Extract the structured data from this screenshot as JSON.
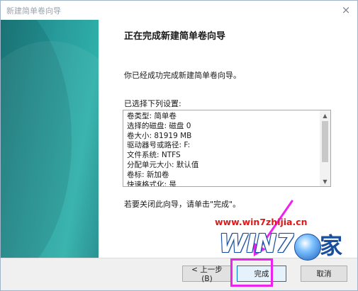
{
  "window": {
    "title": "新建简单卷向导",
    "close_label": "×"
  },
  "content": {
    "heading": "正在完成新建简单卷向导",
    "intro": "你已经成功完成新建简单卷向导。",
    "list_label": "已选择下列设置:",
    "settings": [
      "卷类型: 简单卷",
      "选择的磁盘: 磁盘 0",
      "卷大小: 81919 MB",
      "驱动器号或路径: F:",
      "文件系统: NTFS",
      "分配单元大小: 默认值",
      "卷标: 新加卷",
      "快速格式化: 是"
    ],
    "finish_hint": "若要关闭此向导，请单击\"完成\"。",
    "scroll_up": "▲",
    "scroll_down": "▼"
  },
  "footer": {
    "back_label": "< 上一步(B)",
    "finish_label": "完成",
    "cancel_label": "取消"
  },
  "watermark": {
    "url": "www.win7zhijia.cn",
    "logo": "WIN7",
    "jia": "家"
  },
  "colors": {
    "annotation": "#ee22ee",
    "watermark_red": "#e01818",
    "watermark_blue": "#1a4fa0"
  }
}
